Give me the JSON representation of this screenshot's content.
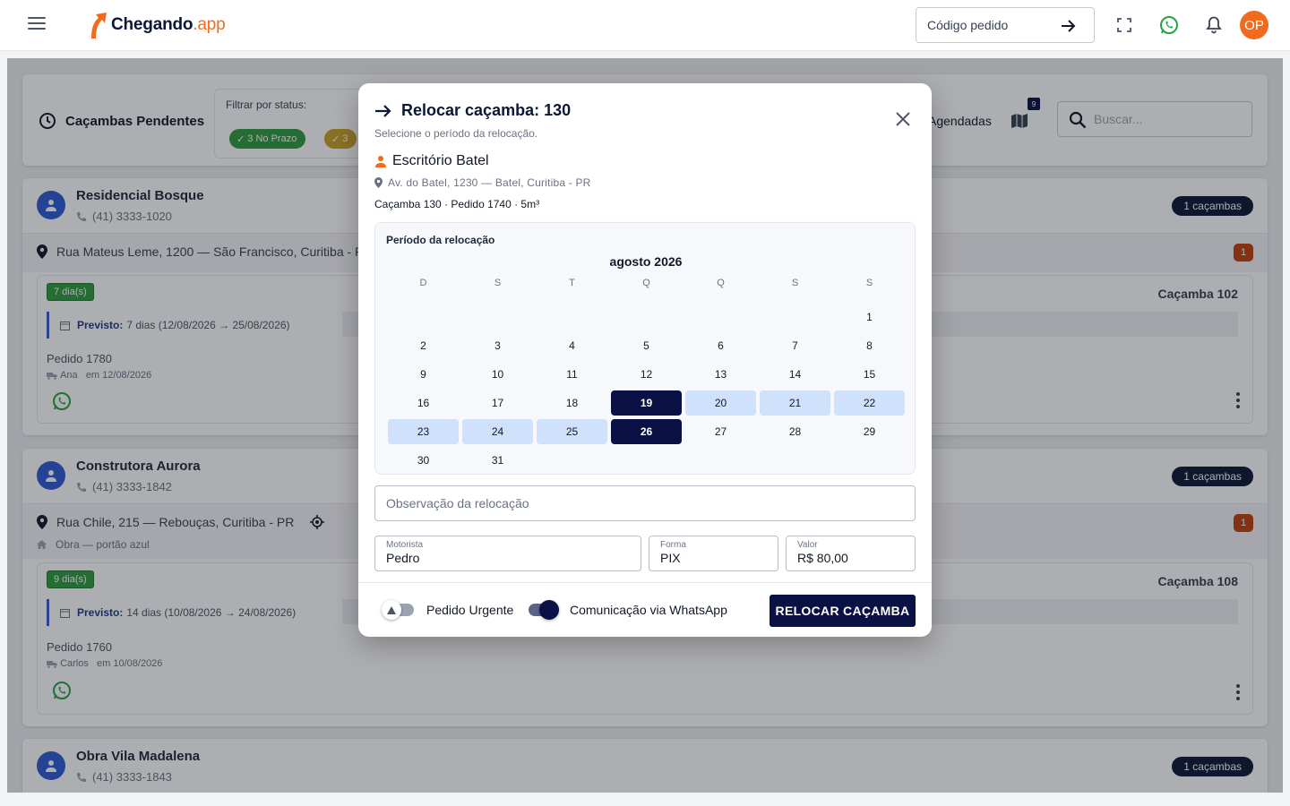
{
  "topbar": {
    "logo_name": "Chegando",
    "logo_suffix": ".app",
    "order_code_placeholder": "Código pedido",
    "avatar_initials": "OP"
  },
  "page": {
    "title": "Caçambas Pendentes",
    "filter_label": "Filtrar por status:",
    "chips": [
      "3 No Prazo",
      "3"
    ],
    "scheduled_label": "Agendadas",
    "map_badge": "9",
    "search_placeholder": "Buscar..."
  },
  "clients": [
    {
      "name": "Residencial Bosque",
      "phone": "(41) 3333-1020",
      "containers": "1 caçambas",
      "address": "Rua Mateus Leme, 1200 — São Francisco, Curitiba - PR",
      "alerts": "1",
      "days": "7 dia(s)",
      "forecast_label": "Previsto:",
      "forecast": "7 dias (12/08/2026 → 25/08/2026)",
      "order": "Pedido 1780",
      "driver": "Ana",
      "date": "em 12/08/2026",
      "container_label": "Caçamba 102"
    },
    {
      "name": "Construtora Aurora",
      "phone": "(41) 3333-1842",
      "containers": "1 caçambas",
      "address": "Rua Chile, 215 — Rebouças, Curitiba - PR",
      "note": "Obra — portão azul",
      "alerts": "1",
      "days": "9 dia(s)",
      "forecast_label": "Previsto:",
      "forecast": "14 dias (10/08/2026 → 24/08/2026)",
      "order": "Pedido 1760",
      "driver": "Carlos",
      "date": "em 10/08/2026",
      "container_label": "Caçamba 108"
    },
    {
      "name": "Obra Vila Madalena",
      "phone": "(41) 3333-1843",
      "containers": "1 caçambas"
    }
  ],
  "modal": {
    "title": "Relocar caçamba: 130",
    "subtitle": "Selecione o período da relocação.",
    "client": "Escritório Batel",
    "address": "Av. do Batel, 1230 — Batel, Curitiba - PR",
    "meta": "Caçamba 130 · Pedido 1740 · 5m³",
    "calendar": {
      "label": "Período da relocação",
      "month": "agosto 2026",
      "weekdays": [
        "D",
        "S",
        "T",
        "Q",
        "Q",
        "S",
        "S"
      ],
      "first_weekday_index": 6,
      "days_in_month": 31,
      "selected": [
        19,
        26
      ],
      "range": [
        20,
        21,
        22,
        23,
        24,
        25
      ]
    },
    "observation_placeholder": "Observação da relocação",
    "driver_label": "Motorista",
    "driver": "Pedro",
    "payment_label": "Forma",
    "payment": "PIX",
    "value_label": "Valor",
    "value": "R$ 80,00",
    "urgent_label": "Pedido Urgente",
    "urgent_on": false,
    "whatsapp_label": "Comunicação via WhatsApp",
    "whatsapp_on": true,
    "submit_label": "RELOCAR CAÇAMBA"
  },
  "colors": {
    "brand_navy": "#0a1145",
    "brand_orange": "#f26b1d",
    "whatsapp_green": "#25a244",
    "range_blue": "#cfe1fb"
  }
}
